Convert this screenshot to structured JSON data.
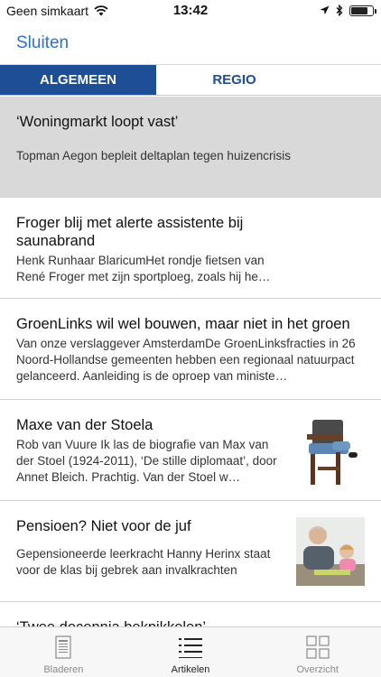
{
  "status": {
    "carrier": "Geen simkaart",
    "time": "13:42"
  },
  "nav": {
    "close_label": "Sluiten"
  },
  "tabs": [
    {
      "label": "ALGEMEEN",
      "active": true
    },
    {
      "label": "REGIO",
      "active": false
    }
  ],
  "articles": [
    {
      "title": "‘Woningmarkt loopt vast’",
      "lead": "Topman Aegon bepleit deltaplan tegen huizencrisis"
    },
    {
      "title": "Froger blij met alerte assistente bij saunabrand",
      "lead": "Henk Runhaar BlaricumHet rondje fietsen van René Froger met zijn sportploeg, zoals hij he…"
    },
    {
      "title": "GroenLinks wil wel bouwen, maar niet in het groen",
      "lead": "Van onze verslaggever AmsterdamDe GroenLinksfracties in 26 Noord-Hollandse gemeenten hebben een regionaal natuurpact gelanceerd. Aanleiding is de oproep van ministe…"
    },
    {
      "title": "Maxe van der Stoela",
      "lead": "Rob van Vuure Ik las de biografie van Max van der Stoel (1924-2011), ‘De stille diplomaat’, door Annet Bleich. Prachtig. Van der Stoel w…"
    },
    {
      "title": "Pensioen? Niet voor de juf",
      "lead": "Gepensioneerde leerkracht Hanny Herinx staat voor de klas bij gebrek aan invalkrachten"
    },
    {
      "title": "‘Twee decennia bekpikkelen’",
      "lead": ""
    }
  ],
  "tabbar": [
    {
      "label": "Bladeren",
      "icon": "page-icon",
      "active": false
    },
    {
      "label": "Artikelen",
      "icon": "list-icon",
      "active": true
    },
    {
      "label": "Overzicht",
      "icon": "grid-icon",
      "active": false
    }
  ],
  "colors": {
    "accent": "#2a6fdb",
    "tab_active_bg": "#1e4e96",
    "highlight_row": "#d9d9d9"
  }
}
